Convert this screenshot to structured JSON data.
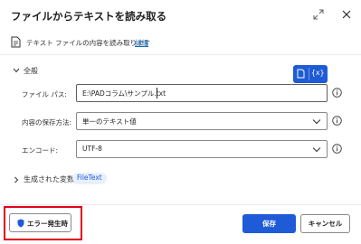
{
  "dialog": {
    "title": "ファイルからテキストを読み取る",
    "description": "テキスト ファイルの内容を読み取ります",
    "details_link": "詳細"
  },
  "general": {
    "section_label": "全般",
    "variables_button_label": "{x}",
    "fields": [
      {
        "label": "ファイル パス:",
        "value": "E:\\PADコラム\\サンプル.txt"
      },
      {
        "label": "内容の保存方法:",
        "value": "単一のテキスト値"
      },
      {
        "label": "エンコード:",
        "value": "UTF-8"
      }
    ]
  },
  "generated_variables": {
    "section_label": "生成された変数",
    "badge": "FileText"
  },
  "footer": {
    "on_error_label": "エラー発生時",
    "save_label": "保存",
    "cancel_label": "キャンセル"
  },
  "colors": {
    "accent": "#1f5bd6",
    "highlight": "#e0001b"
  },
  "icons": [
    "expand-icon",
    "close-icon",
    "document-icon",
    "chevron-down-icon",
    "chevron-right-icon",
    "info-icon",
    "shield-icon"
  ]
}
